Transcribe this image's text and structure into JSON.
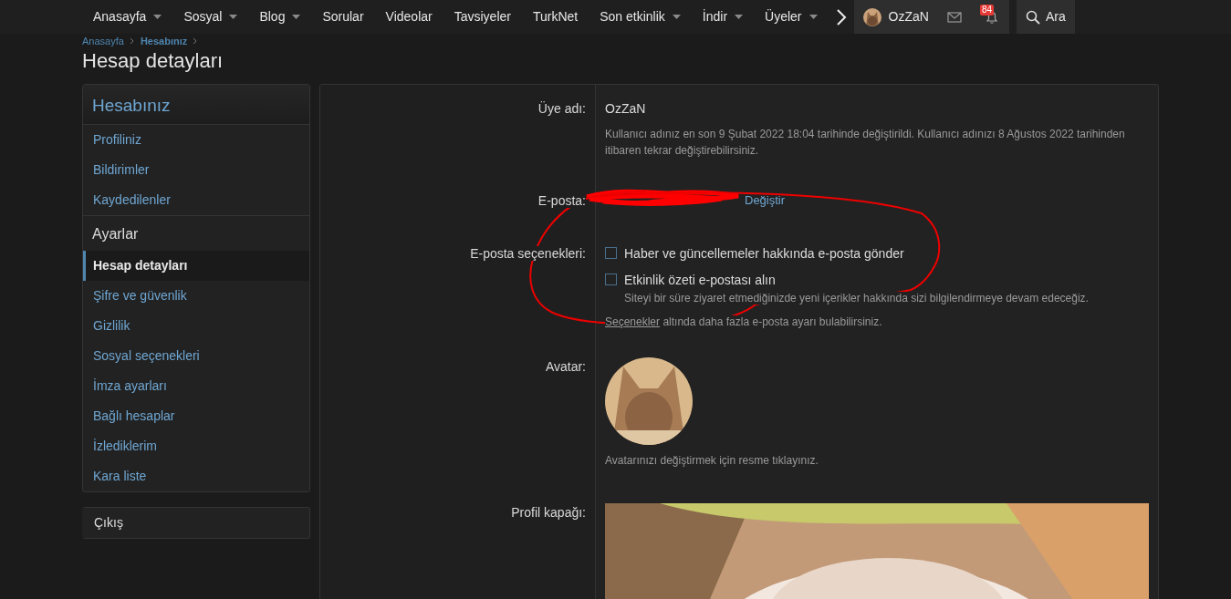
{
  "nav": {
    "items": [
      {
        "label": "Anasayfa",
        "dropdown": true
      },
      {
        "label": "Sosyal",
        "dropdown": true
      },
      {
        "label": "Blog",
        "dropdown": true
      },
      {
        "label": "Sorular",
        "dropdown": false
      },
      {
        "label": "Videolar",
        "dropdown": false
      },
      {
        "label": "Tavsiyeler",
        "dropdown": false
      },
      {
        "label": "TurkNet",
        "dropdown": false
      },
      {
        "label": "Son etkinlik",
        "dropdown": true
      },
      {
        "label": "İndir",
        "dropdown": true
      },
      {
        "label": "Üyeler",
        "dropdown": true
      }
    ],
    "user": "OzZaN",
    "alerts_badge": "84",
    "search": "Ara"
  },
  "breadcrumb": [
    "Anasayfa",
    "Hesabınız"
  ],
  "title": "Hesap detayları",
  "sidebar": {
    "header": "Hesabınız",
    "items": [
      {
        "label": "Profiliniz",
        "selected": false
      },
      {
        "label": "Bildirimler",
        "selected": false
      },
      {
        "label": "Kaydedilenler",
        "selected": false
      }
    ],
    "section": "Ayarlar",
    "settings": [
      {
        "label": "Hesap detayları",
        "selected": true
      },
      {
        "label": "Şifre ve güvenlik",
        "selected": false
      },
      {
        "label": "Gizlilik",
        "selected": false
      },
      {
        "label": "Sosyal seçenekleri",
        "selected": false
      },
      {
        "label": "İmza ayarları",
        "selected": false
      },
      {
        "label": "Bağlı hesaplar",
        "selected": false
      },
      {
        "label": "İzlediklerim",
        "selected": false
      },
      {
        "label": "Kara liste",
        "selected": false
      }
    ],
    "logout": "Çıkış"
  },
  "form": [
    {
      "kind": "text",
      "label": "Üye adı:",
      "value": "OzZaN",
      "hint": "Kullanıcı adınız en son 9 Şubat 2022 18:04 tarihinde değiştirildi. Kullanıcı adınızı 8 Ağustos 2022 tarihinden itibaren tekrar değiştirebilirsiniz."
    },
    {
      "kind": "email",
      "label": "E-posta:",
      "link": "Değiştir"
    },
    {
      "kind": "checkboxes",
      "label": "E-posta seçenekleri:",
      "options": [
        {
          "label": "Haber ve güncellemeler hakkında e-posta gönder",
          "checked": false
        },
        {
          "label": "Etkinlik özeti e-postası alın",
          "checked": false,
          "hint": "Siteyi bir süre ziyaret etmediğinizde yeni içerikler hakkında sizi bilgilendirmeye devam edeceğiz."
        }
      ],
      "footer_link": "Seçenekler",
      "footer": "altında daha fazla e-posta ayarı bulabilirsiniz."
    },
    {
      "kind": "avatar",
      "label": "Avatar:",
      "hint": "Avatarınızı değiştirmek için resme tıklayınız."
    },
    {
      "kind": "cover",
      "label": "Profil kapağı:"
    }
  ]
}
